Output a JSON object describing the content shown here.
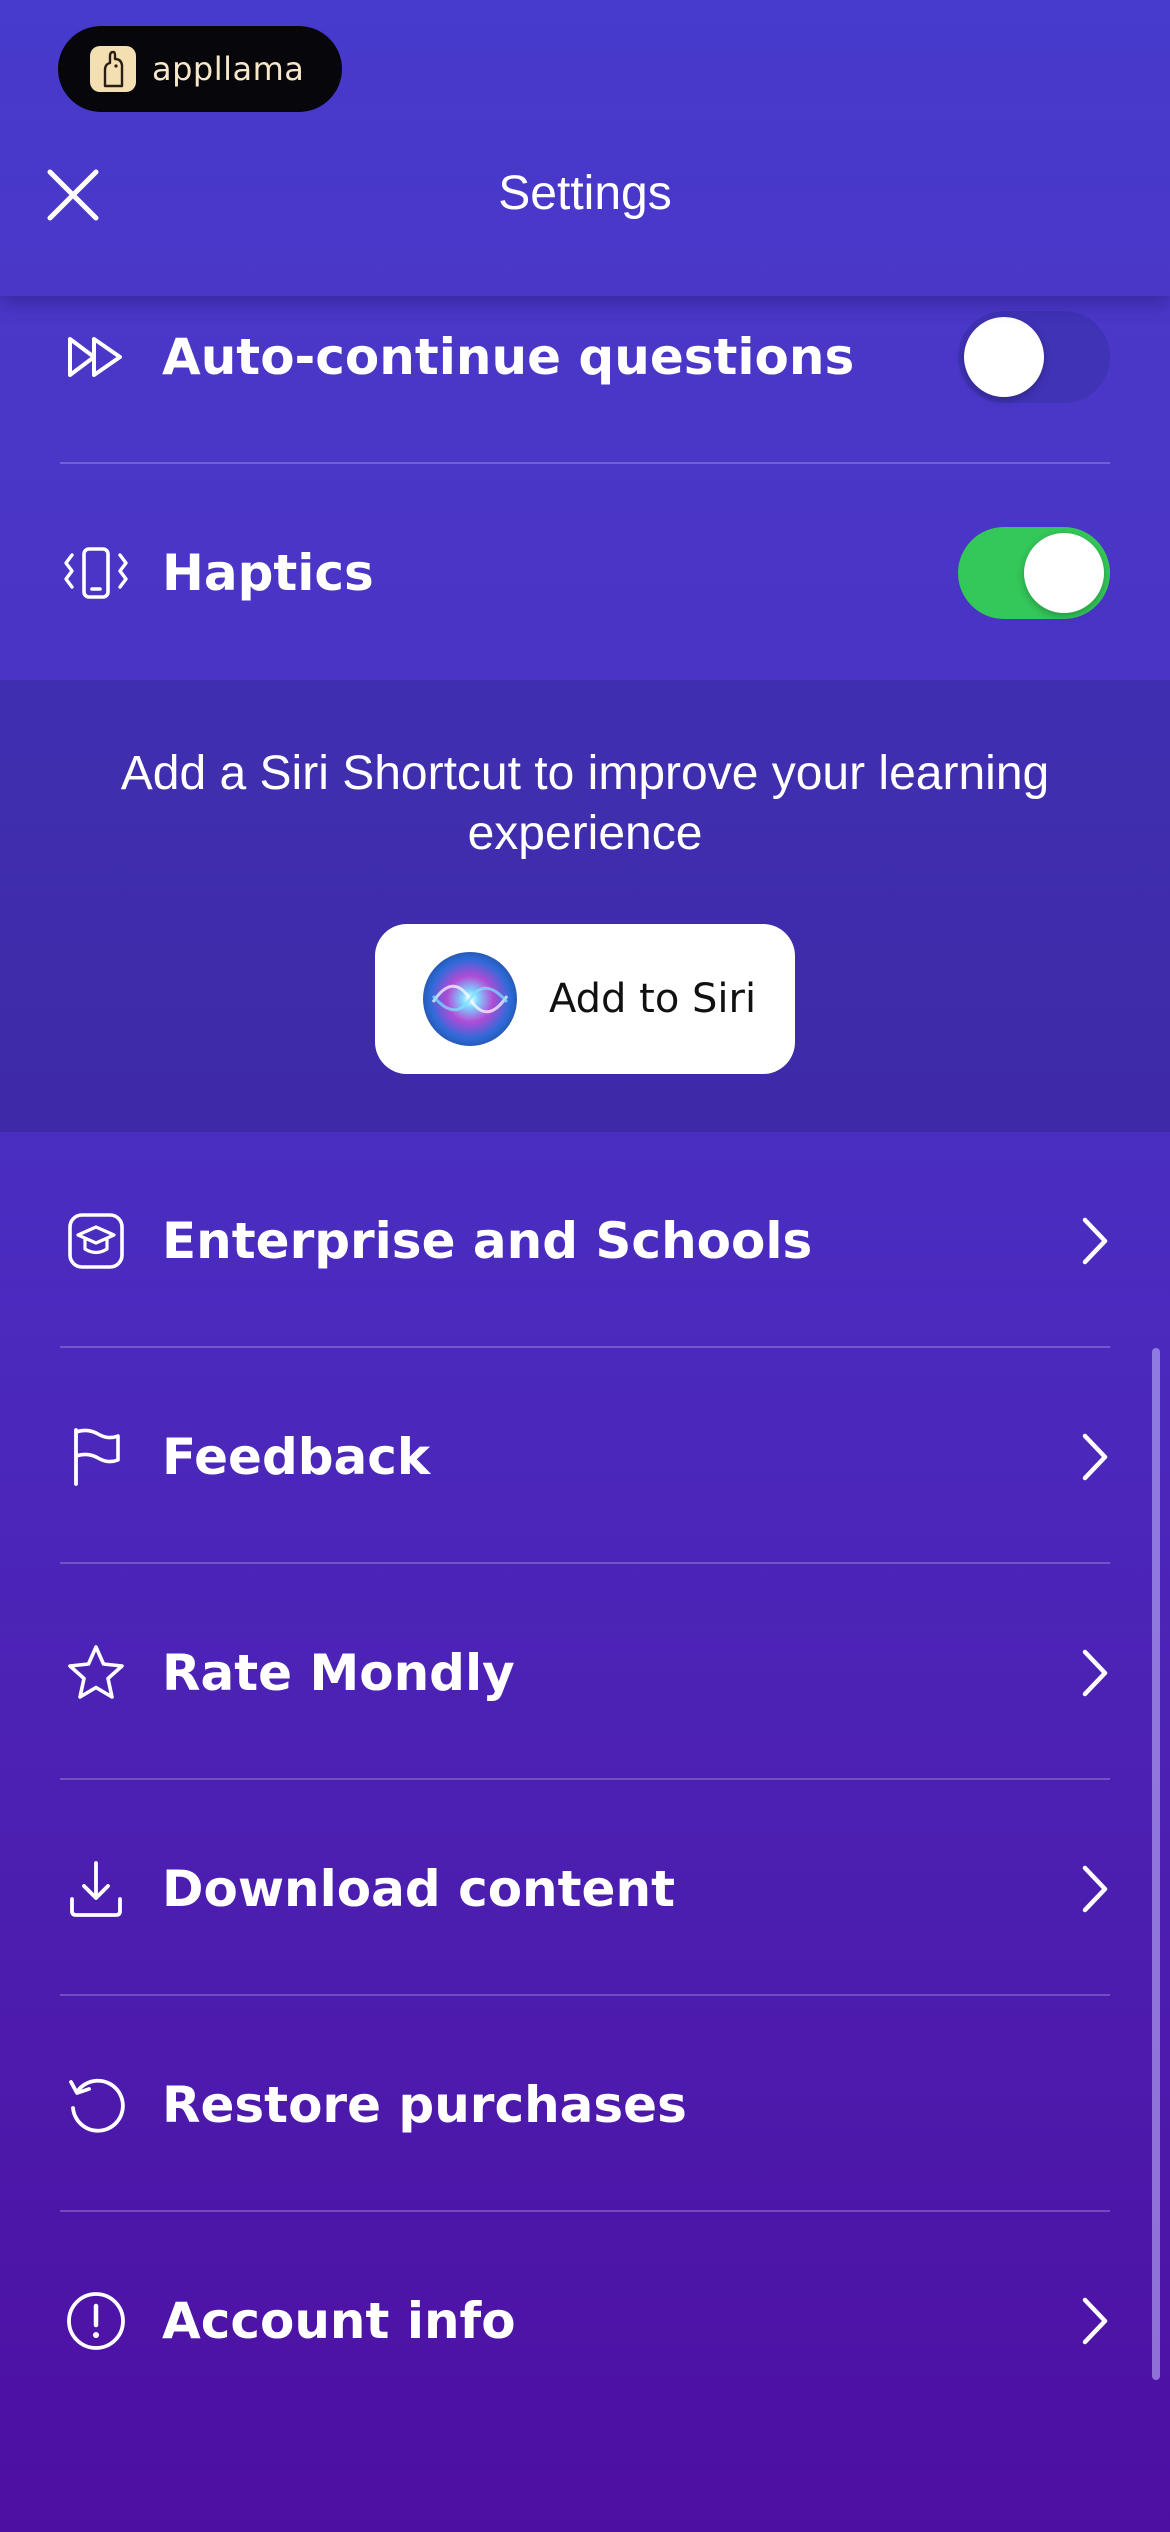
{
  "header": {
    "brand": "appllama",
    "title": "Settings"
  },
  "toggles": [
    {
      "label": "Auto-continue questions",
      "icon": "fast-forward-icon",
      "enabled": false
    },
    {
      "label": "Haptics",
      "icon": "vibration-phone-icon",
      "enabled": true
    }
  ],
  "siri": {
    "text": "Add a Siri Shortcut to improve your learning experience",
    "button_label": "Add to Siri"
  },
  "menu": [
    {
      "label": "Enterprise and Schools",
      "icon": "graduation-cap-icon",
      "chevron": true
    },
    {
      "label": "Feedback",
      "icon": "flag-icon",
      "chevron": true
    },
    {
      "label": "Rate Mondly",
      "icon": "star-icon",
      "chevron": true
    },
    {
      "label": "Download content",
      "icon": "download-icon",
      "chevron": true
    },
    {
      "label": "Restore purchases",
      "icon": "restore-icon",
      "chevron": false
    },
    {
      "label": "Account info",
      "icon": "info-exclamation-icon",
      "chevron": true
    }
  ],
  "colors": {
    "toggle_on": "#34c759",
    "toggle_off": "#3f33b6",
    "background_top": "#4a3bc9",
    "background_bottom": "#4d0fa2"
  }
}
